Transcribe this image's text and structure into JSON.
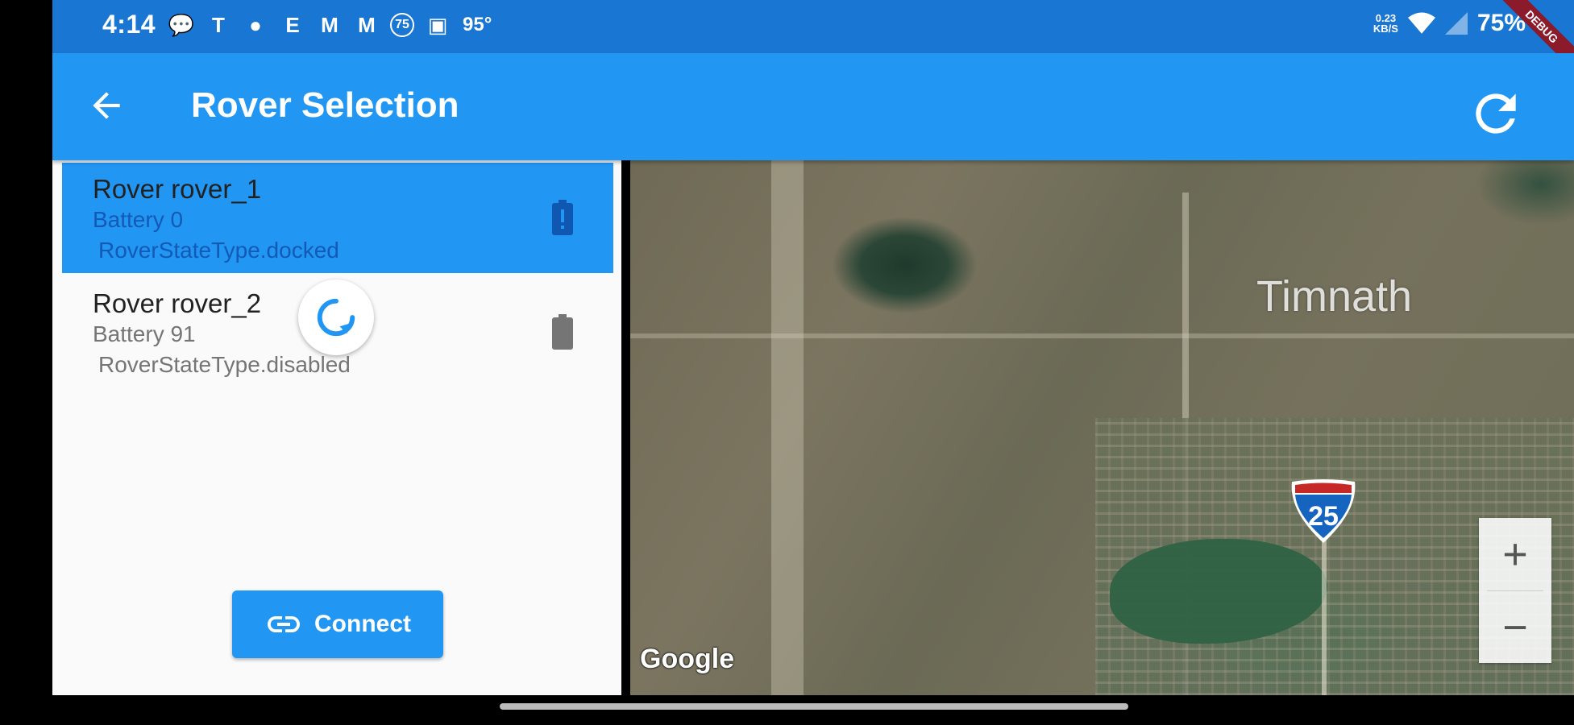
{
  "status_bar": {
    "time": "4:14",
    "notification_icons": [
      {
        "icon": "message-icon",
        "glyph": "💬"
      },
      {
        "icon": "teams-icon",
        "glyph": "T"
      },
      {
        "icon": "reddit-icon",
        "glyph": "●"
      },
      {
        "icon": "engadget-icon",
        "glyph": "E"
      },
      {
        "icon": "gmail-icon",
        "glyph": "M"
      },
      {
        "icon": "gmail-icon",
        "glyph": "M"
      },
      {
        "icon": "badge-75-icon",
        "glyph": "75"
      },
      {
        "icon": "image-icon",
        "glyph": "▣"
      }
    ],
    "temperature": "95°",
    "net_speed_value": "0.23",
    "net_speed_unit": "KB/S",
    "battery": "75%",
    "debug_banner": "DEBUG"
  },
  "app_bar": {
    "title": "Rover Selection",
    "back_icon": "arrow-back-icon",
    "refresh_icon": "refresh-icon"
  },
  "rovers": [
    {
      "name": "Rover rover_1",
      "battery": "Battery 0",
      "state": " RoverStateType.docked",
      "selected": true,
      "battery_level": 0
    },
    {
      "name": "Rover rover_2",
      "battery": "Battery 91",
      "state": " RoverStateType.disabled",
      "selected": false,
      "battery_level": 91
    }
  ],
  "connect_button": {
    "label": "Connect",
    "icon": "link-icon"
  },
  "map": {
    "place_label": "Timnath",
    "highway_shield": "25",
    "provider_logo": "Google",
    "zoom_in": "+",
    "zoom_out": "−"
  },
  "colors": {
    "status_bar": "#1976D2",
    "app_bar": "#2196F3",
    "selected_item": "#2196F3",
    "accent": "#2196F3"
  }
}
